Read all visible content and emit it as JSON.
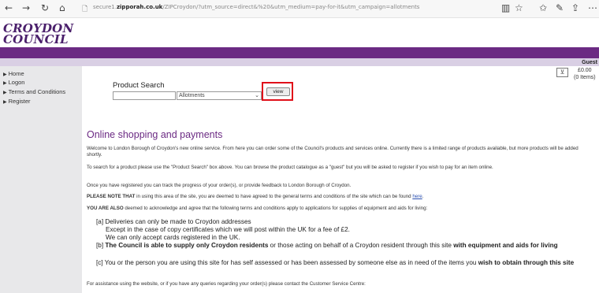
{
  "browser": {
    "back": "←",
    "forward": "→",
    "refresh": "↻",
    "home": "⌂",
    "url_prefix": "secure1.",
    "url_domain": "zipporah.co.uk",
    "url_rest": "/ZIPCroydon/?utm_source=direct&%20&utm_medium=pay-for-it&utm_campaign=allotments",
    "tools": [
      "▥",
      "☆",
      "✩",
      "✎",
      "⇪",
      "⋯"
    ]
  },
  "header": {
    "logo_line1": "CROYDON",
    "logo_line2": "COUNCIL",
    "guest": "Guest"
  },
  "sidebar": {
    "items": [
      {
        "label": "Home"
      },
      {
        "label": "Logon"
      },
      {
        "label": "Terms and Conditions"
      },
      {
        "label": "Register"
      }
    ]
  },
  "cart": {
    "amount": "£0.00",
    "items": "(0 Items)"
  },
  "search": {
    "label": "Product Search",
    "input_value": "",
    "selected_category": "Allotments",
    "view_label": "view"
  },
  "content": {
    "heading": "Online shopping and payments",
    "p1": "Welcome to London Borough of Croydon's new online service. From here you can order some of the Council's products and services online. Currently there is a limited range of products available, but more products will be added shortly.",
    "p2": "To search for a product please use the \"Product Search\" box above. You can browse the product catalogue as a \"guest\" but you will be asked to register if you wish to pay for an item online.",
    "p3": "Once you have registered you can track the progress of your order(s), or provide feedback to London Borough of Croydon.",
    "p4_bold": "PLEASE NOTE THAT",
    "p4_text": " in using this area of the site, you are deemed to have agreed to the general terms and conditions of the site which can be found ",
    "p4_link": "here",
    "p4_end": ".",
    "p5_bold": "YOU ARE ALSO",
    "p5_text": " deemed to acknowledge and agree that the following terms and conditions apply to applications for supplies of equipment and aids for living:",
    "a_line1": "[a] Deliveries can only be made to Croydon addresses",
    "a_line2": "Except in the case of copy certificates which we will post within the UK for a fee of £2.",
    "a_line3": "We can only accept cards registered in the UK.",
    "b_pre": "[b] ",
    "b_bold1": "The Council is able to supply only Croydon residents",
    "b_mid": " or those acting on behalf of a Croydon resident through this site ",
    "b_bold2": "with equipment and aids for living",
    "c_pre": "[c] You or the person you are using this site for has self assessed or has been assessed by someone else as in need of the items you ",
    "c_bold": "wish to obtain through this site",
    "p6": "For assistance using the website, or if you have any queries regarding your order(s) please contact the Customer Service Centre:"
  }
}
